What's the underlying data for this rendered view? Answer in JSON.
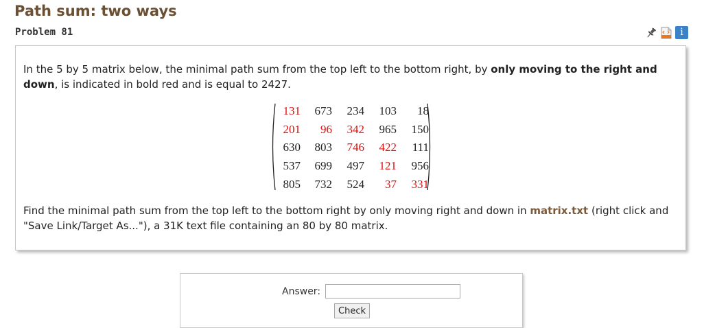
{
  "page": {
    "title": "Path sum: two ways",
    "problem_label": "Problem 81"
  },
  "toolbar": {
    "icons": [
      "pin-icon",
      "html-file-icon",
      "info-icon"
    ],
    "info_glyph": "i"
  },
  "problem": {
    "intro_1": "In the 5 by 5 matrix below, the minimal path sum from the top left to the bottom right, by ",
    "intro_bold": "only moving to the right and down",
    "intro_2": ", is indicated in bold red and is equal to 2427.",
    "matrix": [
      [
        131,
        673,
        234,
        103,
        18
      ],
      [
        201,
        96,
        342,
        965,
        150
      ],
      [
        630,
        803,
        746,
        422,
        111
      ],
      [
        537,
        699,
        497,
        121,
        956
      ],
      [
        805,
        732,
        524,
        37,
        331
      ]
    ],
    "highlight": [
      [
        true,
        false,
        false,
        false,
        false
      ],
      [
        true,
        true,
        true,
        false,
        false
      ],
      [
        false,
        false,
        true,
        true,
        false
      ],
      [
        false,
        false,
        false,
        true,
        false
      ],
      [
        false,
        false,
        false,
        true,
        true
      ]
    ],
    "highlight_color": "#e01010",
    "find_1": "Find the minimal path sum from the top left to the bottom right by only moving right and down in ",
    "find_link": "matrix.txt",
    "find_2": " (right click and \"Save Link/Target As...\"), a 31K text file containing an 80 by 80 matrix."
  },
  "answer": {
    "label": "Answer:",
    "value": "",
    "placeholder": "",
    "check_label": "Check"
  },
  "colors": {
    "title": "#6b4f33",
    "link": "#7a5a3a",
    "info_icon_bg": "#3b83c6"
  }
}
